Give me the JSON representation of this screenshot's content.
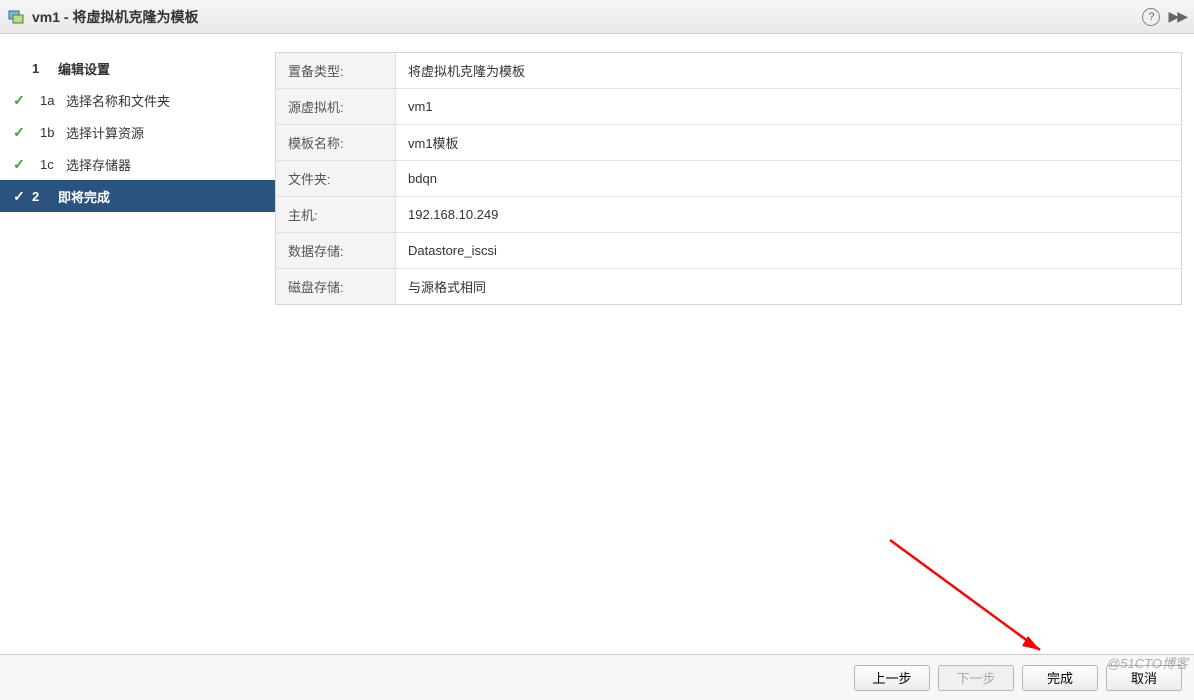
{
  "titlebar": {
    "title": "vm1 - 将虚拟机克隆为模板"
  },
  "sidebar": {
    "steps": [
      {
        "num": "1",
        "label": "编辑设置",
        "type": "main",
        "checked": false
      },
      {
        "num": "1a",
        "label": "选择名称和文件夹",
        "type": "sub",
        "checked": true
      },
      {
        "num": "1b",
        "label": "选择计算资源",
        "type": "sub",
        "checked": true
      },
      {
        "num": "1c",
        "label": "选择存储器",
        "type": "sub",
        "checked": true
      },
      {
        "num": "2",
        "label": "即将完成",
        "type": "main",
        "checked": true,
        "active": true
      }
    ]
  },
  "summary": {
    "rows": [
      {
        "label": "置备类型:",
        "value": "将虚拟机克隆为模板"
      },
      {
        "label": "源虚拟机:",
        "value": "vm1"
      },
      {
        "label": "模板名称:",
        "value": "vm1模板"
      },
      {
        "label": "文件夹:",
        "value": "bdqn"
      },
      {
        "label": "主机:",
        "value": "192.168.10.249"
      },
      {
        "label": "数据存储:",
        "value": "Datastore_iscsi"
      },
      {
        "label": "磁盘存储:",
        "value": "与源格式相同"
      }
    ]
  },
  "footer": {
    "back": "上一步",
    "next": "下一步",
    "finish": "完成",
    "cancel": "取消"
  },
  "watermark": "@51CTO博客"
}
